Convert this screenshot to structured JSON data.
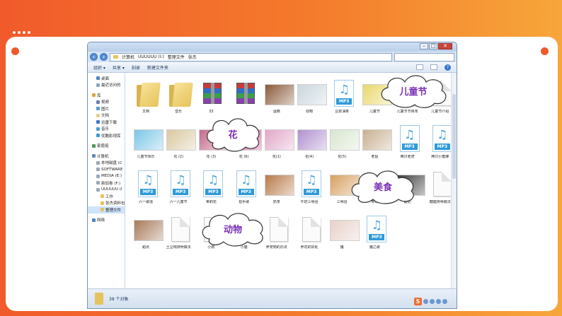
{
  "address": {
    "crumbs": [
      "计算机",
      "UUUUUU (I:)",
      "整理文件",
      "张杰"
    ]
  },
  "window": {
    "min": "–",
    "max": "□",
    "close": "✕"
  },
  "toolbar": {
    "organize": "组织 ▾",
    "share": "共享 ▾",
    "burn": "刻录",
    "new_folder": "新建文件夹"
  },
  "nav": {
    "favorites": [
      {
        "label": "桌面"
      },
      {
        "label": "最近访问的"
      }
    ],
    "libraries_header": "库",
    "libraries": [
      {
        "label": "视频"
      },
      {
        "label": "图片"
      },
      {
        "label": "文档"
      },
      {
        "label": "迅雷下载"
      },
      {
        "label": "音乐"
      },
      {
        "label": "优酷影视库"
      }
    ],
    "homegroup": "家庭组",
    "computer_header": "计算机",
    "drives": [
      {
        "label": "本地磁盘 (C"
      },
      {
        "label": "SOFTWARE"
      },
      {
        "label": "MEDIA (E:)"
      },
      {
        "label": "新加卷 (F:)"
      },
      {
        "label": "UUUUUU (I"
      }
    ],
    "folders": [
      {
        "label": "工作"
      },
      {
        "label": "张杰资料包"
      },
      {
        "label": "整理文件"
      }
    ],
    "network": "网络"
  },
  "files": [
    {
      "label": "文档",
      "kind": "folder"
    },
    {
      "label": "音乐",
      "kind": "folder"
    },
    {
      "label": "33",
      "kind": "rar"
    },
    {
      "label": "",
      "kind": "rar"
    },
    {
      "label": "蛋糕",
      "kind": "photo",
      "color": "#8a5a3a"
    },
    {
      "label": "动物",
      "kind": "photo",
      "color": "#c9d6de"
    },
    {
      "label": "豆浆油条",
      "kind": "mp3"
    },
    {
      "label": "儿童节",
      "kind": "photo",
      "color": "#e8d86a"
    },
    {
      "label": "儿童节节目单",
      "kind": "doc"
    },
    {
      "label": "儿童节介绍",
      "kind": "doc"
    },
    {
      "label": "儿童节快乐",
      "kind": "photo",
      "color": "#7cc6e8"
    },
    {
      "label": "花 (2)",
      "kind": "photo",
      "color": "#d9c8a0"
    },
    {
      "label": "花 (3)",
      "kind": "photo",
      "color": "#c46a8a"
    },
    {
      "label": "花 (6)",
      "kind": "photo",
      "color": "#d64a9a"
    },
    {
      "label": "花(1)",
      "kind": "photo",
      "color": "#e2a7c8"
    },
    {
      "label": "花(4)",
      "kind": "photo",
      "color": "#b090d0"
    },
    {
      "label": "花(5)",
      "kind": "photo",
      "color": "#d8e6d0"
    },
    {
      "label": "老鼠",
      "kind": "photo",
      "color": "#c8b090"
    },
    {
      "label": "两只老虎",
      "kind": "mp3"
    },
    {
      "label": "两只小蜜蜂",
      "kind": "mp3"
    },
    {
      "label": "六一歌谣",
      "kind": "mp3"
    },
    {
      "label": "六一儿童节",
      "kind": "mp3"
    },
    {
      "label": "茉莉花",
      "kind": "mp3"
    },
    {
      "label": "拍手歌",
      "kind": "mp3"
    },
    {
      "label": "奶茶",
      "kind": "photo",
      "color": "#b87a4a"
    },
    {
      "label": "牛奶三明治",
      "kind": "mp3"
    },
    {
      "label": "三明治",
      "kind": "photo",
      "color": "#d8a060"
    },
    {
      "label": "寿司",
      "kind": "photo",
      "color": "#8a9a5a"
    },
    {
      "label": "甜奶",
      "kind": "photo",
      "color": "#3a3a3a"
    },
    {
      "label": "糖醋排骨做法",
      "kind": "doc"
    },
    {
      "label": "甜点",
      "kind": "photo",
      "color": "#a87a5a"
    },
    {
      "label": "土豆炖排骨做法",
      "kind": "doc"
    },
    {
      "label": "小狗",
      "kind": "doc"
    },
    {
      "label": "小猫",
      "kind": "doc"
    },
    {
      "label": "养宠物的办法",
      "kind": "doc"
    },
    {
      "label": "养花的好处",
      "kind": "doc"
    },
    {
      "label": "猪",
      "kind": "photo",
      "color": "#e8d0c8"
    },
    {
      "label": "猪之歌",
      "kind": "mp3"
    }
  ],
  "status": {
    "count": "38 个对象"
  },
  "clouds": {
    "children": "儿童节",
    "flower": "花",
    "food": "美食",
    "animal": "动物"
  },
  "tray": {
    "s": "S"
  }
}
